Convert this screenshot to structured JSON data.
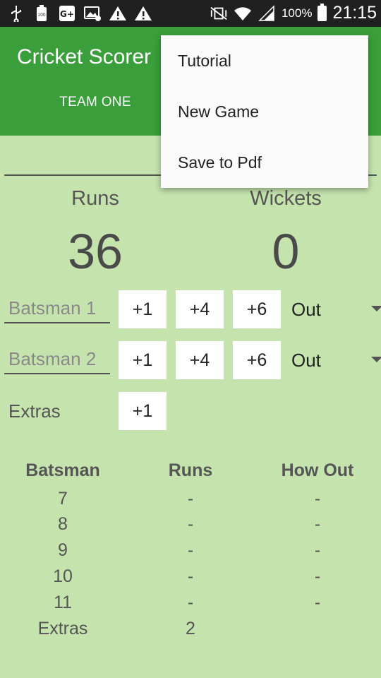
{
  "status_bar": {
    "battery_percent": "100%",
    "time": "21:15",
    "icons": [
      "usb-icon",
      "battery-100-icon",
      "google-plus-icon",
      "image-notification-icon",
      "warning-icon",
      "warning-icon",
      "mute-vibrate-icon",
      "wifi-icon",
      "signal-icon",
      "battery-icon"
    ]
  },
  "app_bar": {
    "title": "Cricket Scorer",
    "tabs": [
      {
        "label": "TEAM ONE"
      }
    ]
  },
  "overflow_menu": {
    "items": [
      {
        "label": "Tutorial"
      },
      {
        "label": "New Game"
      },
      {
        "label": "Save to Pdf"
      }
    ]
  },
  "score": {
    "runs_label": "Runs",
    "wickets_label": "Wickets",
    "runs": "36",
    "wickets": "0"
  },
  "batsman_rows": [
    {
      "placeholder": "Batsman 1",
      "buttons": [
        "+1",
        "+4",
        "+6"
      ],
      "out_label": "Out"
    },
    {
      "placeholder": "Batsman 2",
      "buttons": [
        "+1",
        "+4",
        "+6"
      ],
      "out_label": "Out"
    }
  ],
  "extras_row": {
    "label": "Extras",
    "button": "+1"
  },
  "table": {
    "headers": [
      "Batsman",
      "Runs",
      "How Out"
    ],
    "rows": [
      {
        "batsman": "7",
        "runs": "-",
        "how_out": "-"
      },
      {
        "batsman": "8",
        "runs": "-",
        "how_out": "-"
      },
      {
        "batsman": "9",
        "runs": "-",
        "how_out": "-"
      },
      {
        "batsman": "10",
        "runs": "-",
        "how_out": "-"
      },
      {
        "batsman": "11",
        "runs": "-",
        "how_out": "-"
      },
      {
        "batsman": "Extras",
        "runs": "2",
        "how_out": ""
      }
    ]
  },
  "colors": {
    "app_bar": "#3a9e3a",
    "background": "#c5e3ad",
    "status_bar": "#202020"
  }
}
